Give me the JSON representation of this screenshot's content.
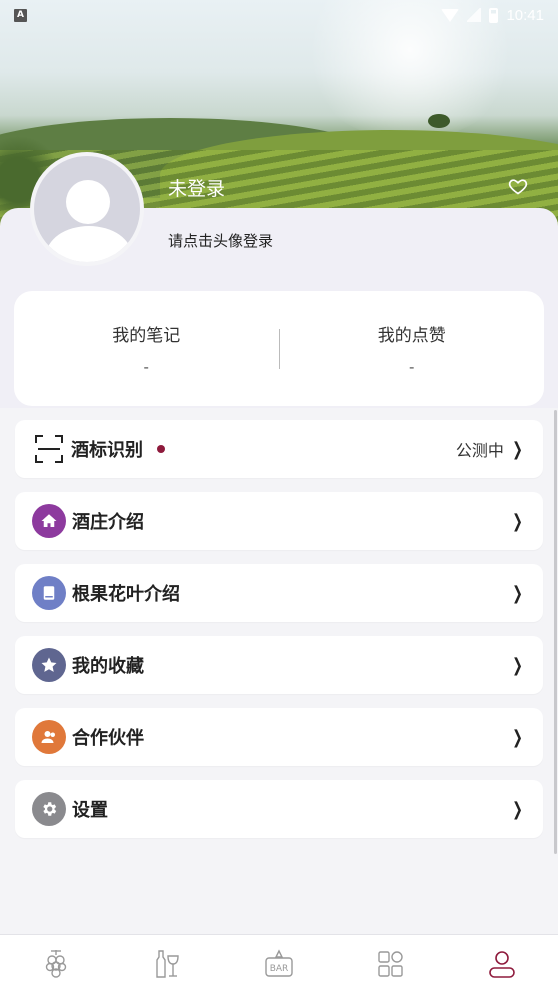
{
  "status_bar": {
    "indicator": "A",
    "time": "10:41",
    "icons": [
      "wifi-icon",
      "no-sim-icon",
      "battery-icon"
    ]
  },
  "profile": {
    "username": "未登录",
    "login_hint": "请点击头像登录"
  },
  "stats": [
    {
      "label": "我的笔记",
      "value": "-"
    },
    {
      "label": "我的点赞",
      "value": "-"
    }
  ],
  "menu": [
    {
      "label": "酒标识别",
      "icon": "scan-icon",
      "right_text": "公测中",
      "has_dot": true
    },
    {
      "label": "酒庄介绍",
      "icon": "home-icon",
      "icon_color": "#8d3a9e"
    },
    {
      "label": "根果花叶介绍",
      "icon": "book-icon",
      "icon_color": "#6f7fc6"
    },
    {
      "label": "我的收藏",
      "icon": "star-icon",
      "icon_color": "#5f6690"
    },
    {
      "label": "合作伙伴",
      "icon": "partner-icon",
      "icon_color": "#e0783a"
    },
    {
      "label": "设置",
      "icon": "gear-icon",
      "icon_color": "#8a8a8e"
    }
  ],
  "bottom_nav": [
    {
      "icon": "grape-icon",
      "active": false
    },
    {
      "icon": "wine-bottle-glass-icon",
      "active": false
    },
    {
      "icon": "bar-icon",
      "label": "BAR",
      "active": false
    },
    {
      "icon": "apps-grid-icon",
      "active": false
    },
    {
      "icon": "profile-icon",
      "active": true
    }
  ],
  "colors": {
    "accent": "#8e1a3c",
    "inactive_nav": "#999999"
  }
}
